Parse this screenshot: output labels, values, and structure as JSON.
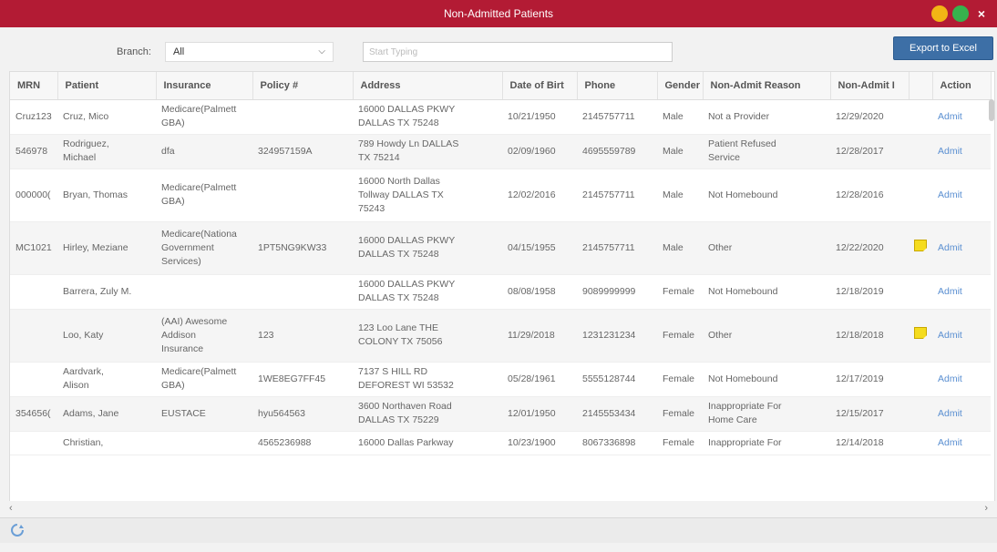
{
  "window": {
    "title": "Non-Admitted Patients",
    "controls": {
      "minimize": "–",
      "maximize": "■",
      "close": "×"
    }
  },
  "toolbar": {
    "branch_label": "Branch:",
    "branch_value": "All",
    "search_placeholder": "Start Typing",
    "export_label": "Export to Excel"
  },
  "table": {
    "columns": [
      "MRN",
      "Patient",
      "Insurance",
      "Policy #",
      "Address",
      "Date of Birt",
      "Phone",
      "Gender",
      "Non-Admit Reason",
      "Non-Admit I",
      "",
      "Action"
    ],
    "rows": [
      {
        "mrn": "Cruz123",
        "patient": "Cruz, Mico",
        "insurance": "Medicare(Palmett\nGBA)",
        "policy": "",
        "address": "16000 DALLAS PKWY\nDALLAS TX 75248",
        "dob": "10/21/1950",
        "phone": "2145757711",
        "gender": "Male",
        "reason": "Not a Provider",
        "date": "12/29/2020",
        "note": false,
        "action": "Admit"
      },
      {
        "mrn": "546978",
        "patient": "Rodriguez,\nMichael",
        "insurance": "dfa",
        "policy": "324957159A",
        "address": "789 Howdy Ln DALLAS\nTX 75214",
        "dob": "02/09/1960",
        "phone": "4695559789",
        "gender": "Male",
        "reason": "Patient Refused\nService",
        "date": "12/28/2017",
        "note": false,
        "action": "Admit"
      },
      {
        "mrn": "000000(",
        "patient": "Bryan, Thomas",
        "insurance": "Medicare(Palmett\nGBA)",
        "policy": "",
        "address": "16000 North Dallas\nTollway DALLAS TX\n75243",
        "dob": "12/02/2016",
        "phone": "2145757711",
        "gender": "Male",
        "reason": "Not Homebound",
        "date": "12/28/2016",
        "note": false,
        "action": "Admit"
      },
      {
        "mrn": "MC1021",
        "patient": "Hirley, Meziane",
        "insurance": "Medicare(Nationa\nGovernment\nServices)",
        "policy": "1PT5NG9KW33",
        "address": "16000 DALLAS PKWY\nDALLAS TX 75248",
        "dob": "04/15/1955",
        "phone": "2145757711",
        "gender": "Male",
        "reason": "Other",
        "date": "12/22/2020",
        "note": true,
        "action": "Admit"
      },
      {
        "mrn": "",
        "patient": "Barrera, Zuly M.",
        "insurance": "",
        "policy": "",
        "address": "16000 DALLAS PKWY\nDALLAS TX 75248",
        "dob": "08/08/1958",
        "phone": "9089999999",
        "gender": "Female",
        "reason": "Not Homebound",
        "date": "12/18/2019",
        "note": false,
        "action": "Admit"
      },
      {
        "mrn": "",
        "patient": "Loo, Katy",
        "insurance": "(AAI) Awesome\nAddison\nInsurance",
        "policy": "123",
        "address": "123 Loo Lane THE\nCOLONY TX 75056",
        "dob": "11/29/2018",
        "phone": "1231231234",
        "gender": "Female",
        "reason": "Other",
        "date": "12/18/2018",
        "note": true,
        "action": "Admit"
      },
      {
        "mrn": "",
        "patient": "Aardvark,\nAlison",
        "insurance": "Medicare(Palmett\nGBA)",
        "policy": "1WE8EG7FF45",
        "address": "7137 S HILL RD\nDEFOREST WI 53532",
        "dob": "05/28/1961",
        "phone": "5555128744",
        "gender": "Female",
        "reason": "Not Homebound",
        "date": "12/17/2019",
        "note": false,
        "action": "Admit"
      },
      {
        "mrn": "354656(",
        "patient": "Adams, Jane",
        "insurance": "EUSTACE",
        "policy": "hyu564563",
        "address": "3600 Northaven Road\nDALLAS TX 75229",
        "dob": "12/01/1950",
        "phone": "2145553434",
        "gender": "Female",
        "reason": "Inappropriate For\nHome Care",
        "date": "12/15/2017",
        "note": false,
        "action": "Admit"
      },
      {
        "mrn": "",
        "patient": "Christian,",
        "insurance": "",
        "policy": "4565236988",
        "address": "16000 Dallas Parkway",
        "dob": "10/23/1900",
        "phone": "8067336898",
        "gender": "Female",
        "reason": "Inappropriate For",
        "date": "12/14/2018",
        "note": false,
        "action": "Admit"
      }
    ]
  },
  "scroll": {
    "left": "‹",
    "right": "›"
  },
  "icons": {
    "refresh": "refresh-icon",
    "note": "note-icon"
  }
}
